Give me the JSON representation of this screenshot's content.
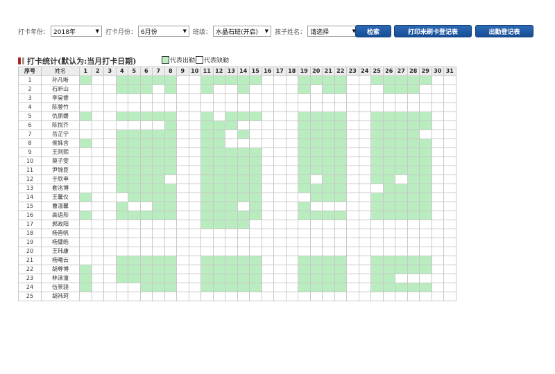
{
  "filters": {
    "year_label": "打卡年份：",
    "year_value": "2018年",
    "month_label": "打卡月份：",
    "month_value": "6月份",
    "class_label": "班级：",
    "class_value": "水晶石班(开启)",
    "child_label": "孩子姓名：",
    "child_value": "请选择"
  },
  "buttons": {
    "search": "检索",
    "print_unswiped": "打印未刷卡登记表",
    "attendance_register": "出勤登记表"
  },
  "section": {
    "title": "打卡统计(默认为:当月打卡日期)"
  },
  "legend": {
    "present": "代表出勤",
    "absent": "代表缺勤",
    "present_color": "#b9ecbf",
    "absent_color": "#ffffff"
  },
  "table": {
    "col_no": "序号",
    "col_name": "姓名",
    "days": [
      "1",
      "2",
      "3",
      "4",
      "5",
      "6",
      "7",
      "8",
      "9",
      "10",
      "11",
      "12",
      "13",
      "14",
      "15",
      "16",
      "17",
      "18",
      "19",
      "20",
      "21",
      "22",
      "23",
      "24",
      "25",
      "26",
      "27",
      "28",
      "29",
      "30",
      "31"
    ],
    "rows": [
      {
        "no": "1",
        "name": "孙凡晰",
        "present": [
          1,
          4,
          5,
          6,
          7,
          8,
          11,
          12,
          13,
          14,
          15,
          19,
          20,
          21,
          22,
          25,
          26,
          27,
          28,
          29
        ]
      },
      {
        "no": "2",
        "name": "石昕山",
        "present": [
          4,
          5,
          6,
          8,
          11,
          14,
          19,
          21,
          22,
          26,
          27,
          28
        ]
      },
      {
        "no": "3",
        "name": "李昊睿",
        "present": []
      },
      {
        "no": "4",
        "name": "陈蓥竹",
        "present": []
      },
      {
        "no": "5",
        "name": "仇丽媛",
        "present": [
          1,
          4,
          5,
          6,
          7,
          8,
          11,
          13,
          14,
          15,
          19,
          20,
          21,
          22,
          25,
          26,
          27,
          28,
          29
        ]
      },
      {
        "no": "6",
        "name": "陈悦芥",
        "present": [
          8,
          11,
          12,
          13,
          19,
          20,
          21,
          22,
          25,
          26,
          27,
          28,
          29
        ]
      },
      {
        "no": "7",
        "name": "岳芷宁",
        "present": [
          4,
          5,
          6,
          7,
          8,
          11,
          12,
          14,
          19,
          20,
          21,
          22,
          25,
          26,
          27,
          28
        ]
      },
      {
        "no": "8",
        "name": "侯姝含",
        "present": [
          1,
          4,
          5,
          6,
          7,
          8,
          11,
          12,
          19,
          20,
          21,
          22,
          25,
          26,
          27,
          28,
          29
        ]
      },
      {
        "no": "9",
        "name": "王则熙",
        "present": [
          4,
          5,
          6,
          7,
          8,
          11,
          12,
          13,
          14,
          15,
          19,
          20,
          21,
          22,
          25,
          26,
          27,
          28,
          29
        ]
      },
      {
        "no": "10",
        "name": "莫子雯",
        "present": [
          4,
          5,
          6,
          7,
          8,
          11,
          12,
          13,
          14,
          15,
          19,
          20,
          21,
          22,
          25,
          26,
          27,
          28,
          29
        ]
      },
      {
        "no": "11",
        "name": "尹锦臣",
        "present": [
          4,
          5,
          6,
          7,
          8,
          11,
          12,
          13,
          14,
          15,
          19,
          20,
          21,
          22,
          25,
          26,
          27,
          28,
          29
        ]
      },
      {
        "no": "12",
        "name": "于欣申",
        "present": [
          4,
          5,
          6,
          7,
          11,
          12,
          13,
          14,
          15,
          19,
          21,
          22,
          25,
          26,
          28,
          29
        ]
      },
      {
        "no": "13",
        "name": "套洺博",
        "present": [
          4,
          5,
          6,
          7,
          8,
          11,
          12,
          13,
          14,
          15,
          19,
          20,
          21,
          22,
          26,
          27,
          28,
          29
        ]
      },
      {
        "no": "14",
        "name": "王馨仪",
        "present": [
          1,
          5,
          6,
          7,
          8,
          11,
          12,
          13,
          14,
          15,
          20,
          21,
          22,
          25,
          26,
          27,
          28,
          29
        ]
      },
      {
        "no": "15",
        "name": "曹温馨",
        "present": [
          4,
          7,
          8,
          11,
          12,
          13,
          15,
          19,
          25,
          26,
          27,
          28,
          29
        ]
      },
      {
        "no": "16",
        "name": "高语彤",
        "present": [
          1,
          4,
          5,
          6,
          7,
          8,
          11,
          12,
          13,
          14,
          15,
          19,
          20,
          21,
          22,
          25,
          26,
          27,
          28,
          29
        ]
      },
      {
        "no": "17",
        "name": "郭政阳",
        "present": [
          11,
          12,
          13,
          14
        ]
      },
      {
        "no": "18",
        "name": "杨晋帆",
        "present": []
      },
      {
        "no": "19",
        "name": "杨璧皓",
        "present": []
      },
      {
        "no": "20",
        "name": "王玮康",
        "present": []
      },
      {
        "no": "21",
        "name": "杨曦云",
        "present": [
          4,
          5,
          6,
          7,
          8,
          11,
          12,
          13,
          14,
          15,
          19,
          20,
          21,
          22,
          25,
          26,
          27,
          28,
          29
        ]
      },
      {
        "no": "22",
        "name": "胡尊博",
        "present": [
          1,
          4,
          5,
          6,
          7,
          8,
          11,
          12,
          13,
          14,
          15,
          19,
          20,
          21,
          22,
          25,
          26,
          27,
          28,
          29
        ]
      },
      {
        "no": "23",
        "name": "林沫潼",
        "present": [
          1,
          4,
          5,
          6,
          7,
          8,
          11,
          12,
          13,
          14,
          15,
          19,
          20,
          21,
          22,
          25,
          26
        ]
      },
      {
        "no": "24",
        "name": "伍景骁",
        "present": [
          1,
          6,
          7,
          8,
          11,
          12,
          13,
          14,
          15,
          19,
          20,
          21,
          22,
          25,
          26,
          27,
          28,
          29
        ]
      },
      {
        "no": "25",
        "name": "胡祎珂",
        "present": []
      }
    ]
  }
}
